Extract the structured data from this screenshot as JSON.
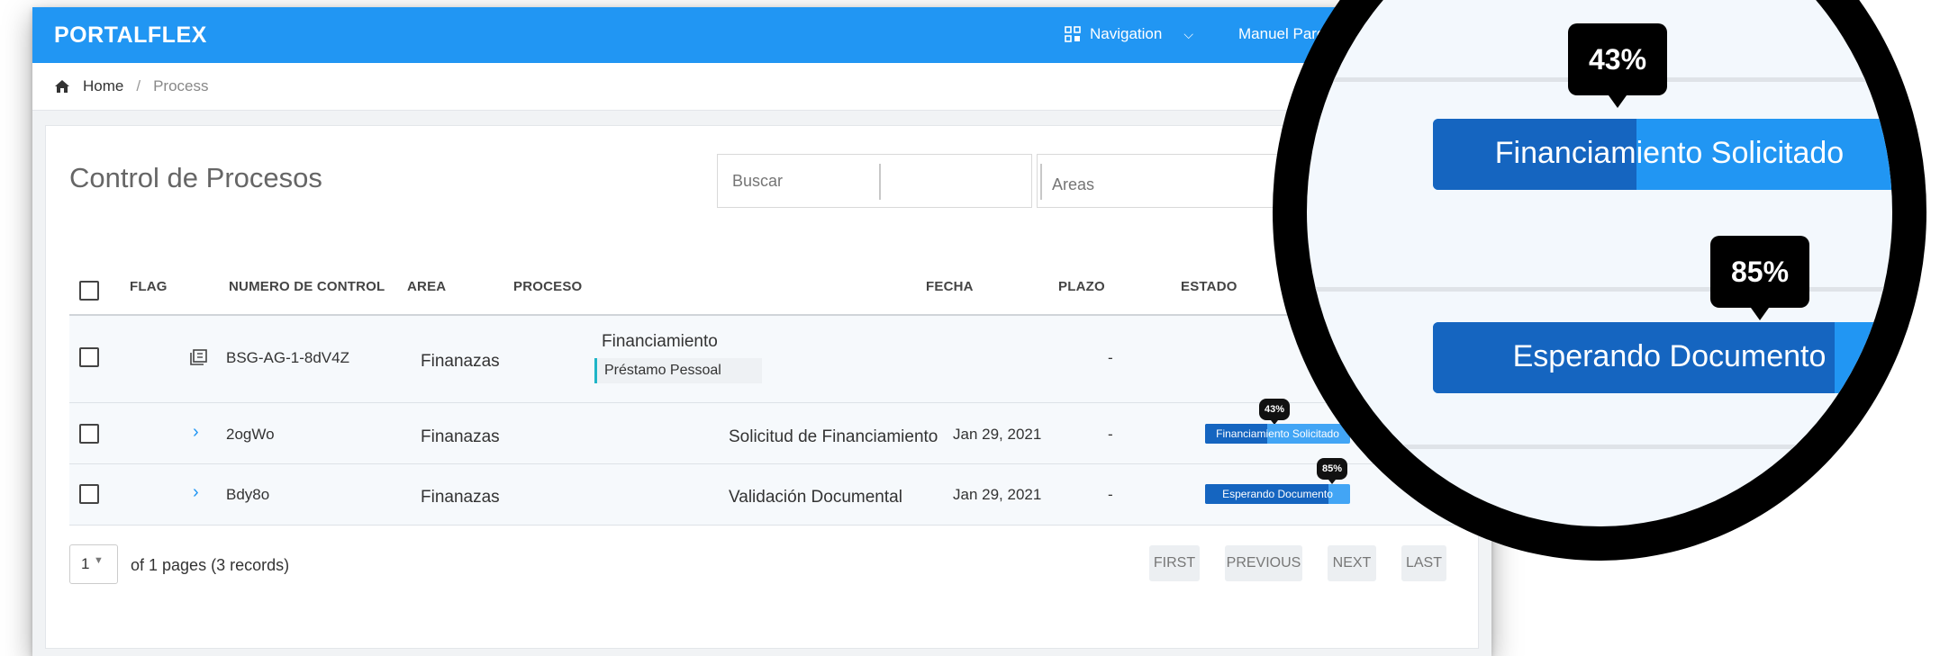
{
  "app": {
    "logo": "PORTALFLEX",
    "nav_label": "Navigation",
    "user_name": "Manuel Pardo",
    "brand_color": "#2196f3"
  },
  "breadcrumb": {
    "home": "Home",
    "separator": "/",
    "current": "Process"
  },
  "page": {
    "title": "Control de Procesos",
    "search_placeholder": "Buscar",
    "areas_placeholder": "Areas"
  },
  "table": {
    "columns": {
      "flag": "FLAG",
      "numero": "NUMERO DE CONTROL",
      "area": "AREA",
      "proceso": "PROCESO",
      "fecha": "FECHA",
      "plazo": "PLAZO",
      "estado": "ESTADO"
    },
    "parent_row": {
      "numero": "BSG-AG-1-8dV4Z",
      "area": "Finanazas",
      "proceso": "Financiamiento",
      "tag": "Préstamo Pessoal",
      "plazo": "-"
    },
    "rows": [
      {
        "numero": "2ogWo",
        "area": "Finanazas",
        "proceso": "Solicitud de Financiamiento",
        "fecha": "Jan 29, 2021",
        "plazo": "-",
        "estado": "Financiamiento Solicitado",
        "progress": 0.43,
        "progress_label": "43%"
      },
      {
        "numero": "Bdy8o",
        "area": "Finanazas",
        "proceso": "Validación Documental",
        "fecha": "Jan 29, 2021",
        "plazo": "-",
        "estado": "Esperando Documento",
        "progress": 0.85,
        "progress_label": "85%"
      }
    ]
  },
  "pagination": {
    "page_size": "1",
    "info": "of 1 pages (3 records)",
    "first": "FIRST",
    "previous": "PREVIOUS",
    "next": "NEXT",
    "last": "LAST"
  },
  "zoom": {
    "items": [
      {
        "label": "Financiamiento Solicitado",
        "progress": 0.43,
        "progress_label": "43%"
      },
      {
        "label": "Esperando Documento",
        "progress": 0.85,
        "progress_label": "85%"
      }
    ]
  }
}
